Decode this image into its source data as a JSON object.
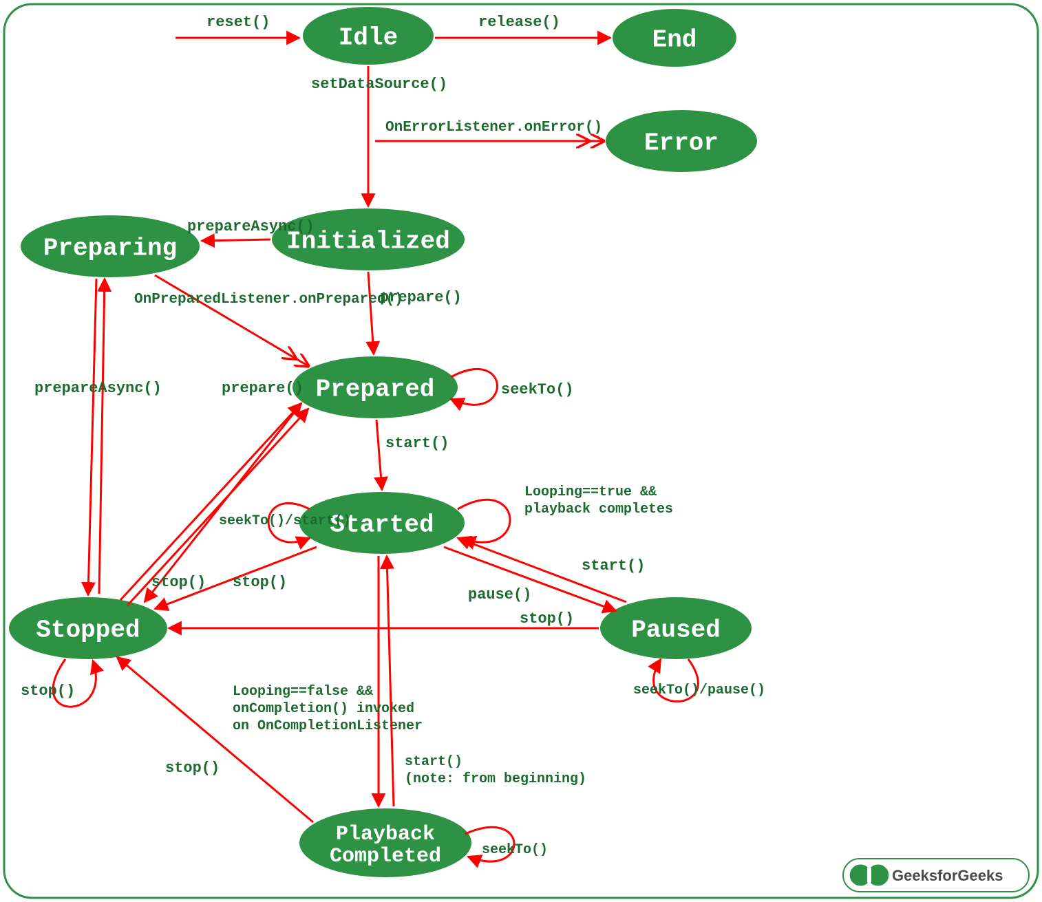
{
  "attribution": "GeeksforGeeks",
  "states": {
    "idle": "Idle",
    "end": "End",
    "error": "Error",
    "initialized": "Initialized",
    "preparing": "Preparing",
    "prepared": "Prepared",
    "started": "Started",
    "stopped": "Stopped",
    "paused": "Paused",
    "playback_completed_l1": "Playback",
    "playback_completed_l2": "Completed"
  },
  "transitions": {
    "reset": "reset()",
    "release": "release()",
    "setDataSource": "setDataSource()",
    "onErrorListener": "OnErrorListener.onError()",
    "prepareAsync_init": "prepareAsync()",
    "prepare_init": "prepare()",
    "onPrepared": "OnPreparedListener.onPrepared()",
    "prepareAsync_stopped": "prepareAsync()",
    "prepare_stopped": "prepare()",
    "seekTo_prepared": "seekTo()",
    "start_prepared": "start()",
    "seekTo_start_started": "seekTo()/start()",
    "looping_true_l1": "Looping==true &&",
    "looping_true_l2": "playback completes",
    "pause_started": "pause()",
    "start_paused": "start()",
    "stop_started": "stop()",
    "stop_prepared": "stop()",
    "stop_paused": "stop()",
    "seekTo_pause_paused": "seekTo()/pause()",
    "stop_stopped": "stop()",
    "looping_false_l1": "Looping==false &&",
    "looping_false_l2": "onCompletion() invoked",
    "looping_false_l3": "on OnCompletionListener",
    "stop_pc": "stop()",
    "start_pc_l1": "start()",
    "start_pc_l2": "(note: from beginning)",
    "seekTo_pc": "seekTo()"
  }
}
